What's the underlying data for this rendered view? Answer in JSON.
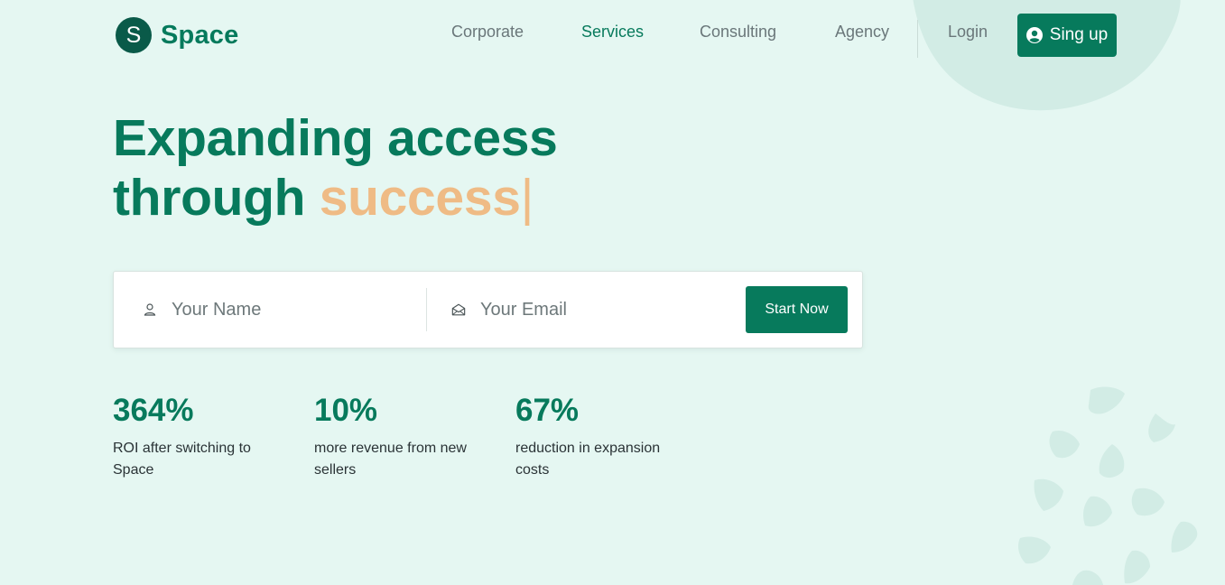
{
  "brand": {
    "logo_letter": "S",
    "name": "Space",
    "primary_color": "#077a5c",
    "accent_color": "#efbb85",
    "background_color": "#e5f7f2"
  },
  "nav": {
    "items": [
      {
        "label": "Corporate",
        "active": false
      },
      {
        "label": "Services",
        "active": true
      },
      {
        "label": "Consulting",
        "active": false
      },
      {
        "label": "Agency",
        "active": false
      },
      {
        "label": "Login",
        "active": false
      }
    ],
    "signup_label": "Sing up",
    "signup_icon": "user-circle-icon"
  },
  "hero": {
    "line1": "Expanding access",
    "line2_prefix": "through",
    "line2_highlight": "success",
    "caret": "|"
  },
  "form": {
    "name_placeholder": "Your Name",
    "name_icon": "user-icon",
    "email_placeholder": "Your Email",
    "email_icon": "envelope-open-icon",
    "submit_label": "Start Now"
  },
  "stats": [
    {
      "value": "364%",
      "label": "ROI after switching to Space"
    },
    {
      "value": "10%",
      "label": "more revenue from new sellers"
    },
    {
      "value": "67%",
      "label": "reduction in expansion costs"
    }
  ]
}
